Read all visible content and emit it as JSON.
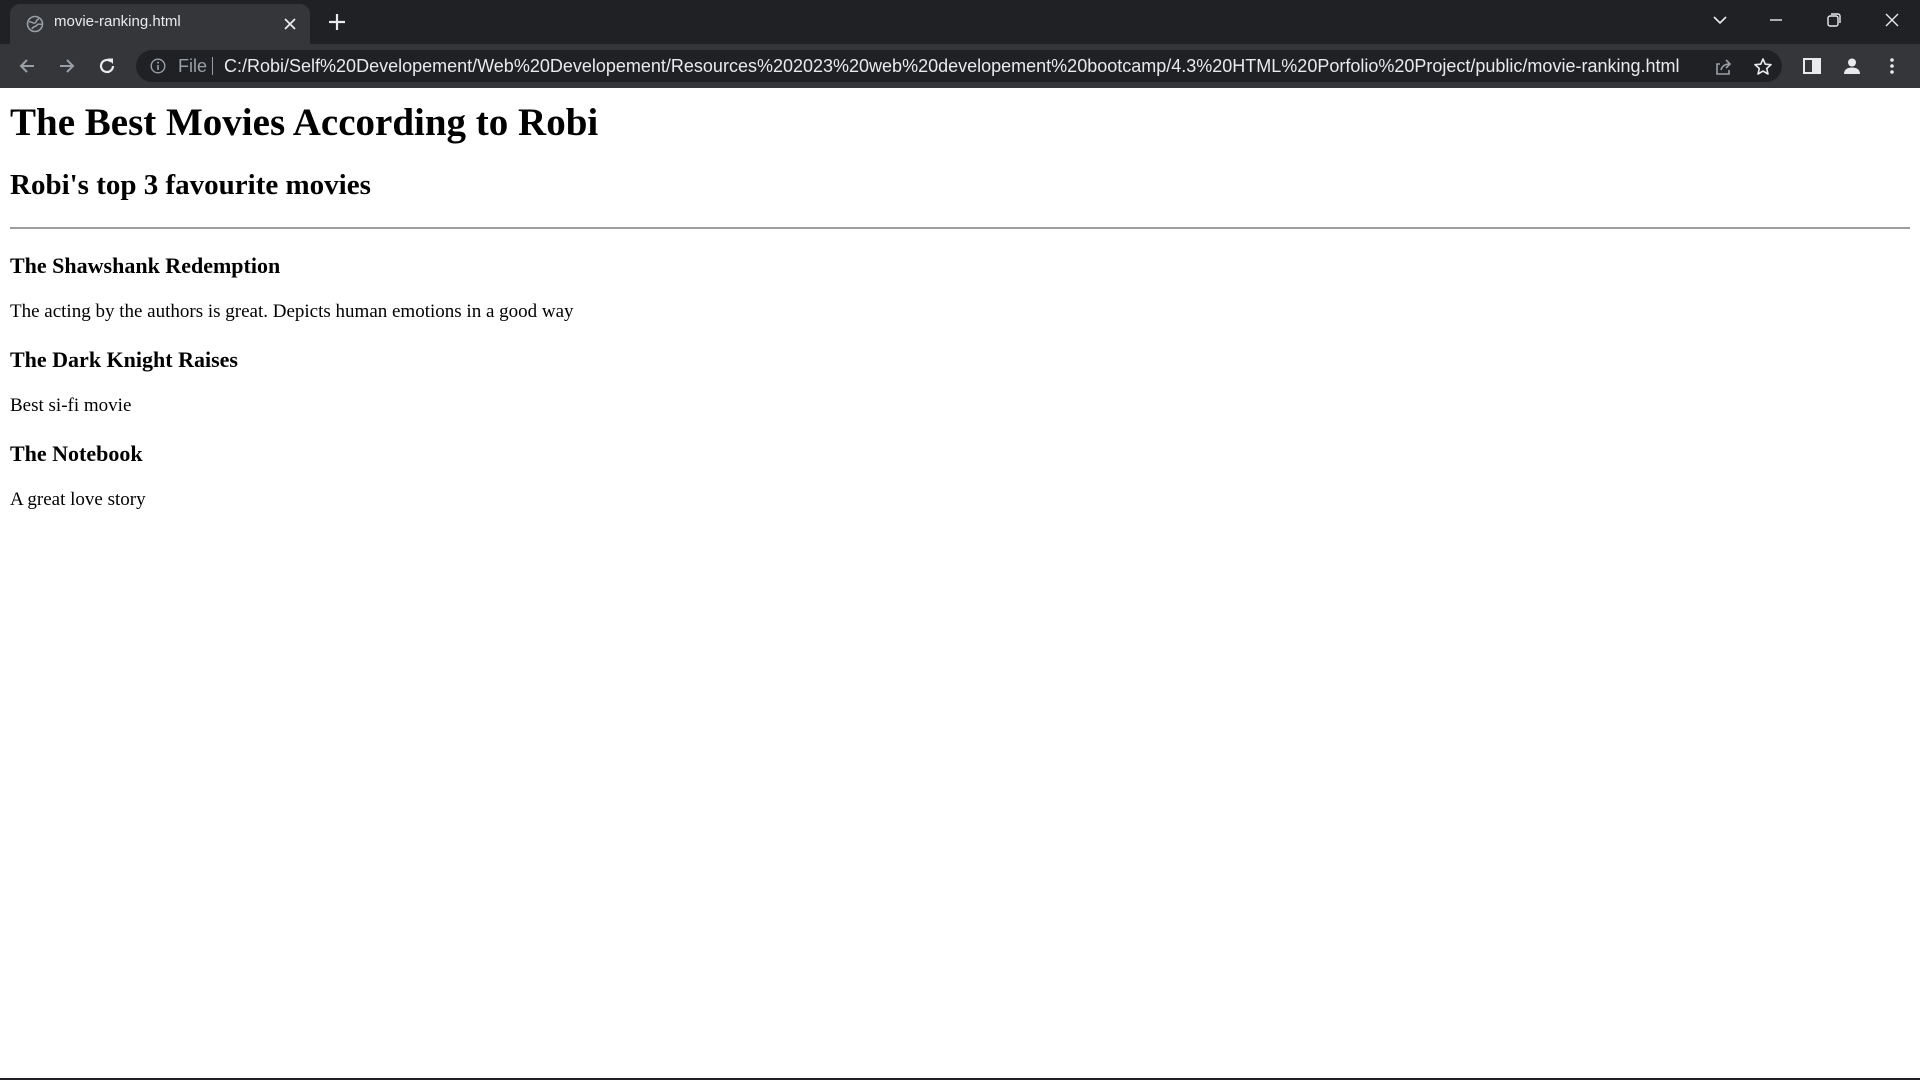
{
  "browser": {
    "tab": {
      "title": "movie-ranking.html"
    },
    "omnibox": {
      "scheme_label": "File",
      "url": "C:/Robi/Self%20Developement/Web%20Developement/Resources%202023%20web%20developement%20bootcamp/4.3%20HTML%20Porfolio%20Project/public/movie-ranking.html"
    },
    "colors": {
      "chrome_dark": "#202124",
      "chrome_tab": "#35363a",
      "chrome_text": "#e8eaed",
      "chrome_muted": "#9aa0a6"
    }
  },
  "page": {
    "title": "The Best Movies According to Robi",
    "subtitle": "Robi's top 3 favourite movies",
    "movies": [
      {
        "name": "The Shawshank Redemption",
        "description": "The acting by the authors is great. Depicts human emotions in a good way"
      },
      {
        "name": "The Dark Knight Raises",
        "description": "Best si-fi movie"
      },
      {
        "name": "The Notebook",
        "description": "A great love story"
      }
    ]
  }
}
